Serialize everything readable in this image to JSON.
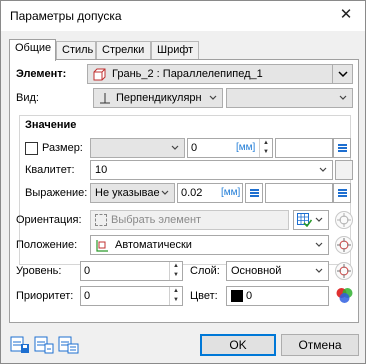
{
  "window": {
    "title": "Параметры допуска"
  },
  "tabs": [
    "Общие",
    "Стиль",
    "Стрелки",
    "Шрифт"
  ],
  "element": {
    "label": "Элемент:",
    "value": "Грань_2 : Параллелепипед_1"
  },
  "view": {
    "label": "Вид:",
    "value": "Перпендикулярн",
    "second_value": ""
  },
  "value_group": {
    "title": "Значение",
    "size": {
      "label": "Размер:",
      "value": "",
      "number": "0",
      "unit": "[мм]",
      "extra": ""
    },
    "quality": {
      "label": "Квалитет:",
      "value": "10"
    },
    "expression": {
      "label": "Выражение:",
      "value": "Не указывае",
      "number": "0.02",
      "unit": "[мм]",
      "extra": ""
    }
  },
  "orientation": {
    "label": "Ориентация:",
    "placeholder": "Выбрать элемент"
  },
  "position": {
    "label": "Положение:",
    "value": "Автоматически"
  },
  "level": {
    "label": "Уровень:",
    "value": "0"
  },
  "layer": {
    "label": "Слой:",
    "value": "Основной"
  },
  "priority": {
    "label": "Приоритет:",
    "value": "0"
  },
  "color": {
    "label": "Цвет:",
    "value": "0",
    "swatch": "#000000"
  },
  "buttons": {
    "ok": "OK",
    "cancel": "Отмена"
  },
  "accent": "#0078d7"
}
